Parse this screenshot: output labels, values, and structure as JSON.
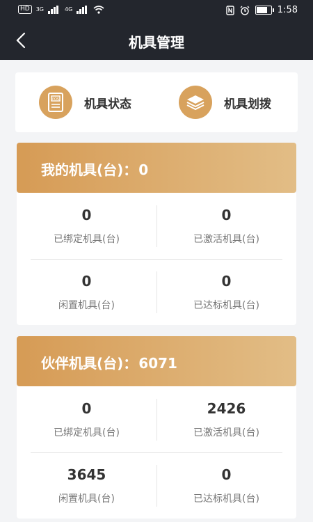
{
  "statusbar": {
    "hd_label": "HD",
    "network1": "3G",
    "network2": "4G",
    "time": "1:58"
  },
  "navbar": {
    "title": "机具管理"
  },
  "quick_actions": [
    {
      "label": "机具状态",
      "icon": "pos-terminal-icon"
    },
    {
      "label": "机具划拨",
      "icon": "stack-layers-icon"
    }
  ],
  "my_devices": {
    "title": "我的机具(台)：",
    "value": "0",
    "stats": [
      {
        "value": "0",
        "label": "已绑定机具(台)"
      },
      {
        "value": "0",
        "label": "已激活机具(台)"
      },
      {
        "value": "0",
        "label": "闲置机具(台)"
      },
      {
        "value": "0",
        "label": "已达标机具(台)"
      }
    ]
  },
  "partner_devices": {
    "title": "伙伴机具(台)：",
    "value": "6071",
    "stats": [
      {
        "value": "0",
        "label": "已绑定机具(台)"
      },
      {
        "value": "2426",
        "label": "已激活机具(台)"
      },
      {
        "value": "3645",
        "label": "闲置机具(台)"
      },
      {
        "value": "0",
        "label": "已达标机具(台)"
      }
    ]
  },
  "colors": {
    "header_bg": "#23262d",
    "accent": "#d8a25d",
    "gradient_start": "#d69b55",
    "gradient_end": "#e2bd86"
  }
}
